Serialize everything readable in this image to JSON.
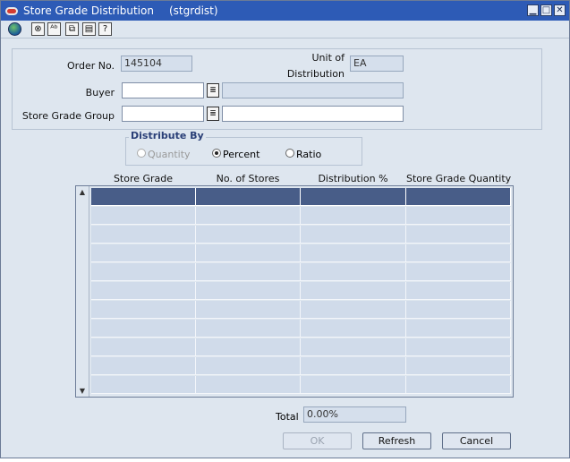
{
  "window": {
    "title": "Store Grade Distribution",
    "code": "(stgrdist)",
    "controls": {
      "minimize": "▁",
      "maximize": "□",
      "close": "✕"
    }
  },
  "toolbar": {
    "icons": [
      "globe-icon",
      "navigation-icon",
      "spell-check-icon",
      "clipboard-icon",
      "print-icon",
      "help-icon"
    ],
    "glyphs": {
      "nav": "⊗",
      "spell": "ᴬᵇ",
      "clip": "⧉",
      "print": "▤",
      "help": "?"
    }
  },
  "form": {
    "order_no_label": "Order No.",
    "order_no_value": "145104",
    "uod_label_line1": "Unit of",
    "uod_label_line2": "Distribution",
    "uod_value": "EA",
    "buyer_label": "Buyer",
    "buyer_value": "",
    "buyer_desc": "",
    "store_grade_group_label": "Store Grade Group",
    "store_grade_group_value": "",
    "store_grade_group_desc": "",
    "lov_glyph": "≣"
  },
  "distribute_by": {
    "title": "Distribute By",
    "options": [
      "Quantity",
      "Percent",
      "Ratio"
    ],
    "selected": "Percent"
  },
  "grid": {
    "columns": [
      "Store Grade",
      "No. of Stores",
      "Distribution %",
      "Store Grade Quantity"
    ],
    "row_count": 11
  },
  "total": {
    "label": "Total",
    "value": "0.00%"
  },
  "buttons": {
    "ok": "OK",
    "refresh": "Refresh",
    "cancel": "Cancel"
  }
}
